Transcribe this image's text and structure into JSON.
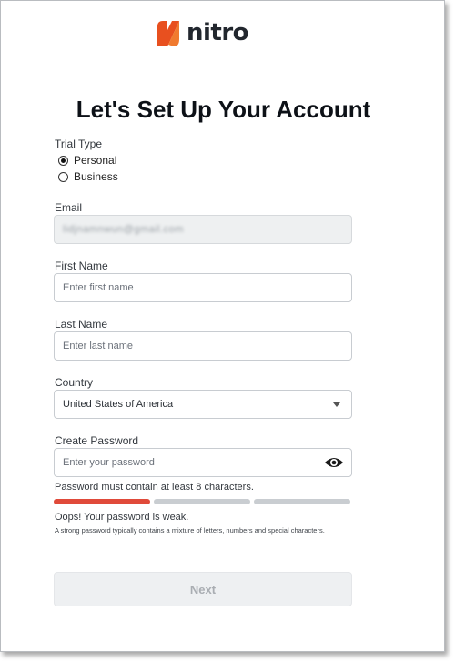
{
  "brand": {
    "name": "nitro",
    "accent": "#e8501f"
  },
  "heading": "Let's Set Up Your Account",
  "trial_type": {
    "label": "Trial Type",
    "options": [
      {
        "label": "Personal",
        "checked": true
      },
      {
        "label": "Business",
        "checked": false
      }
    ]
  },
  "email": {
    "label": "Email",
    "value": "lidjnamnwun@gmail.com"
  },
  "first_name": {
    "label": "First Name",
    "placeholder": "Enter first name"
  },
  "last_name": {
    "label": "Last Name",
    "placeholder": "Enter last name"
  },
  "country": {
    "label": "Country",
    "value": "United States of America"
  },
  "password": {
    "label": "Create Password",
    "placeholder": "Enter your password",
    "requirement": "Password must contain at least 8 characters.",
    "strength_filled_segments": 1,
    "strength_total_segments": 3,
    "strength_message": "Oops! Your password is weak.",
    "strength_tip": "A strong password typically contains a mixture of letters, numbers and special characters."
  },
  "next_button": {
    "label": "Next"
  },
  "colors": {
    "weak": "#e04a3a",
    "track": "#c9cdd1",
    "disabled_button": "#eef0f2"
  }
}
